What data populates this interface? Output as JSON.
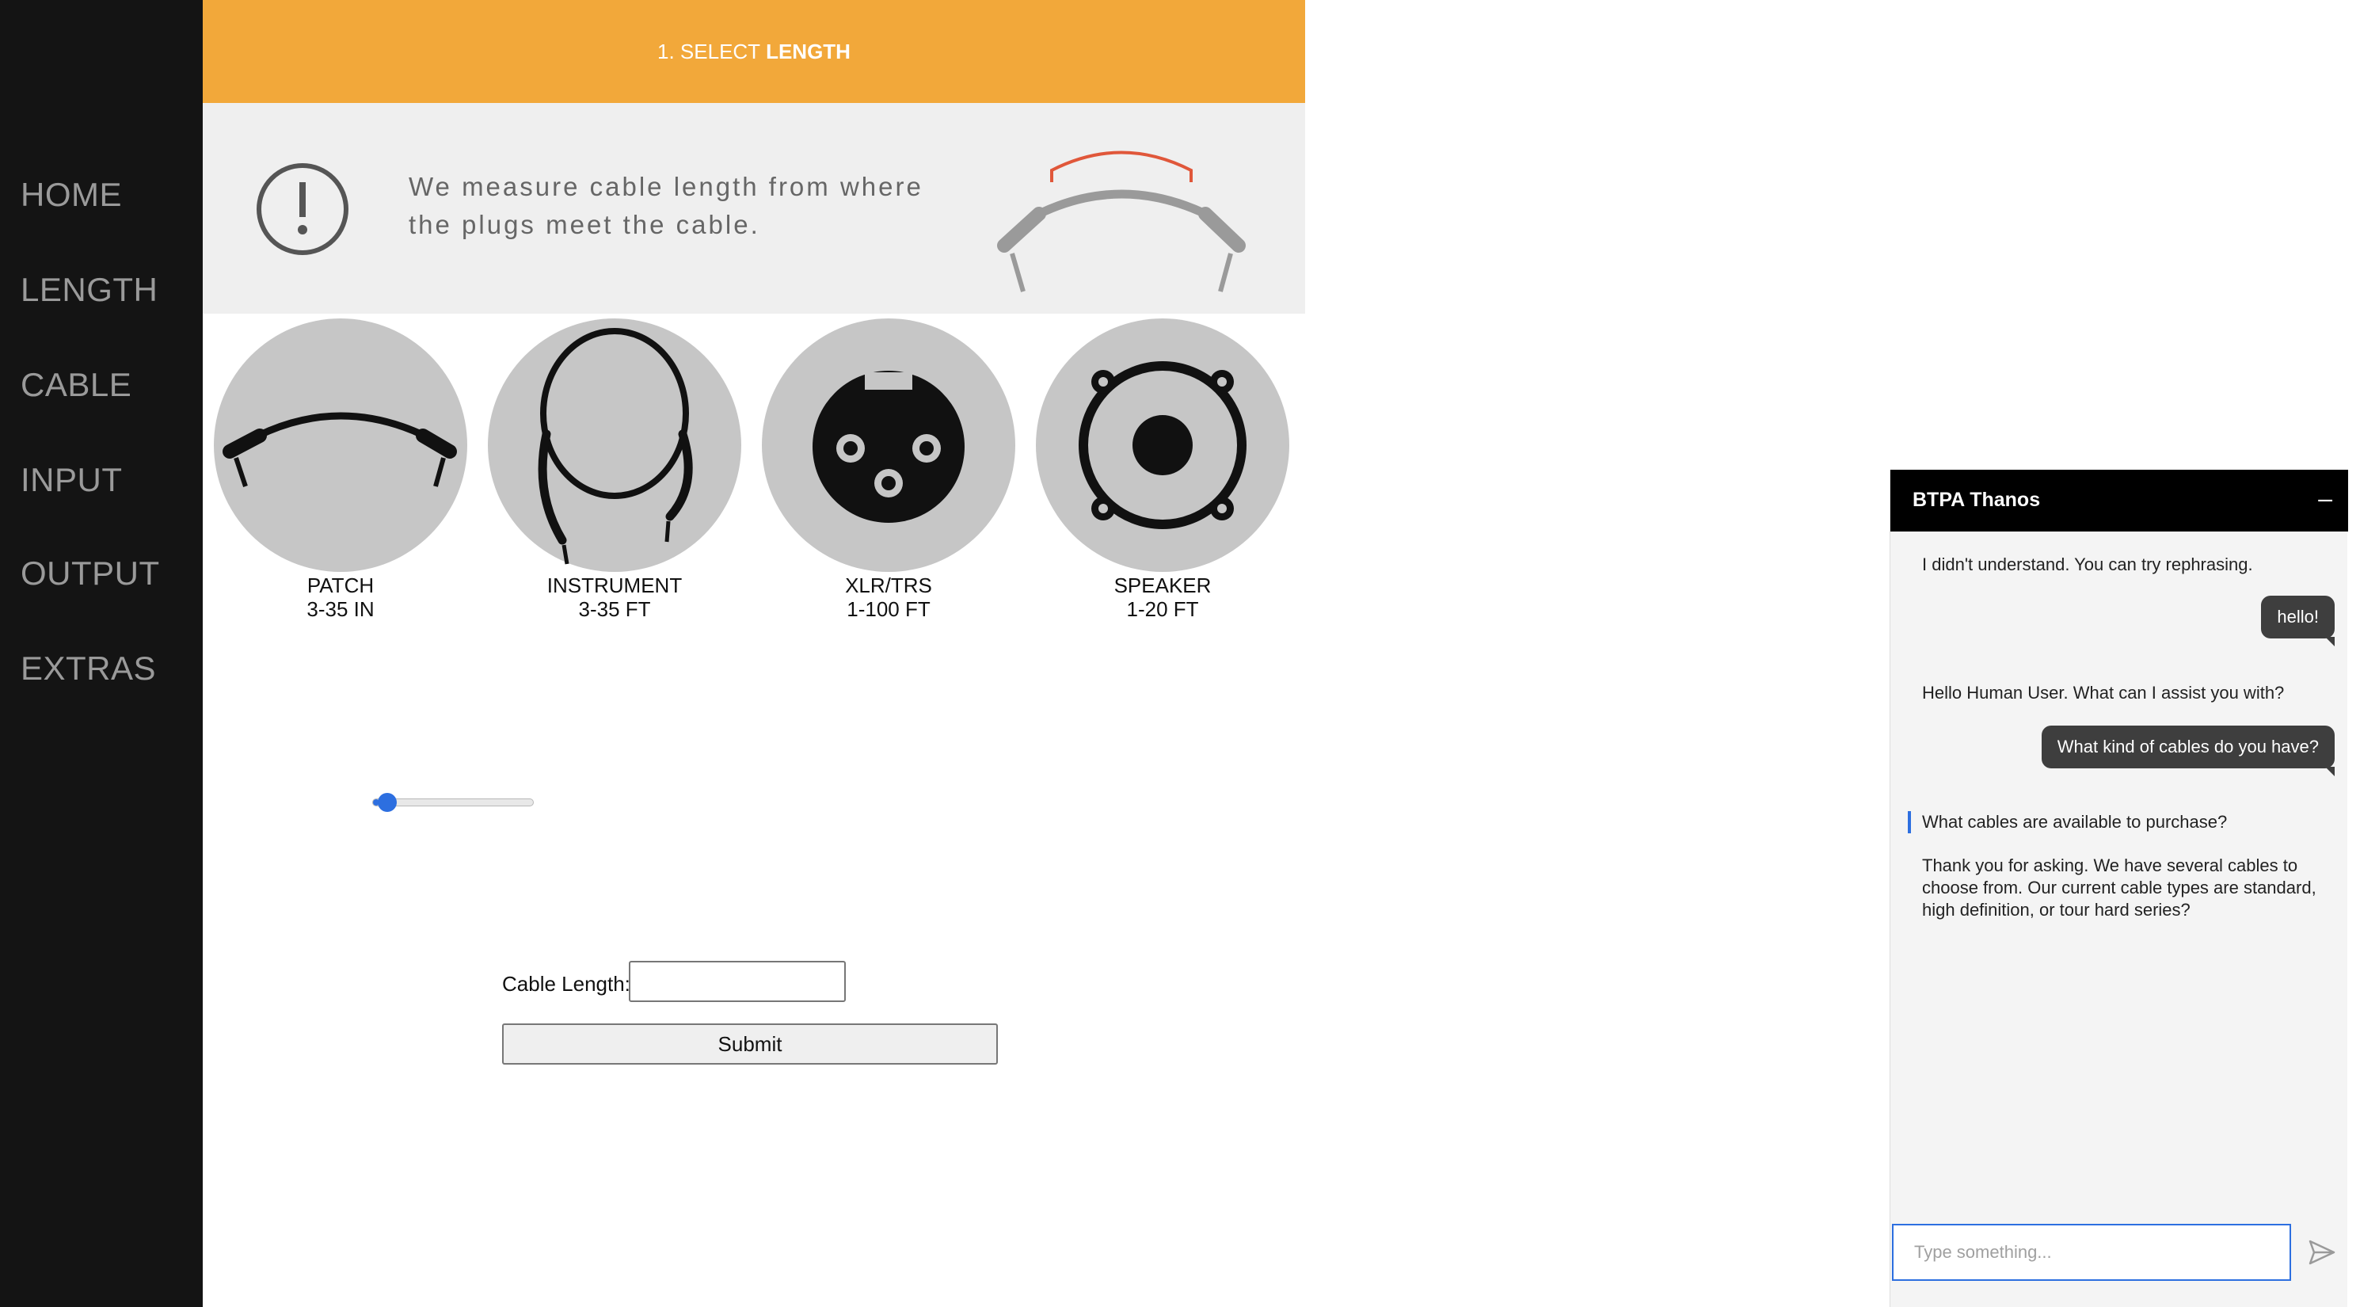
{
  "sidebar": {
    "items": [
      {
        "label": "HOME"
      },
      {
        "label": "LENGTH"
      },
      {
        "label": "CABLE"
      },
      {
        "label": "INPUT"
      },
      {
        "label": "OUTPUT"
      },
      {
        "label": "EXTRAS"
      }
    ]
  },
  "header": {
    "step_prefix": "1. SELECT",
    "step_bold": "LENGTH"
  },
  "info_banner": {
    "text_line1": "We measure cable length from where",
    "text_line2": "the plugs meet the cable."
  },
  "cable_options": [
    {
      "name": "PATCH",
      "range": "3-35 IN",
      "icon": "patch-cable-icon"
    },
    {
      "name": "INSTRUMENT",
      "range": "3-35 FT",
      "icon": "instrument-cable-icon"
    },
    {
      "name": "XLR/TRS",
      "range": "1-100 FT",
      "icon": "xlr-connector-icon"
    },
    {
      "name": "SPEAKER",
      "range": "1-20 FT",
      "icon": "speaker-icon"
    }
  ],
  "slider": {
    "value_fraction": 0.04
  },
  "form": {
    "length_label": "Cable Length:",
    "length_value": "",
    "submit_label": "Submit"
  },
  "chat": {
    "title": "BTPA Thanos",
    "minimize_label": "–",
    "input_placeholder": "Type something...",
    "messages": [
      {
        "from": "bot",
        "text": "I didn't understand. You can try rephrasing."
      },
      {
        "from": "user",
        "text": "hello!"
      },
      {
        "from": "bot",
        "text": "Hello Human User. What can I assist you with?"
      },
      {
        "from": "user",
        "text": "What kind of cables do you have?"
      },
      {
        "from": "bot",
        "text": "What cables are available to purchase?"
      },
      {
        "from": "bot",
        "text": "Thank you for asking. We have several cables to choose from. Our current cable types are standard, high definition, or tour hard series?"
      }
    ]
  },
  "colors": {
    "header_bg": "#f2a83a",
    "sidebar_bg": "#141414",
    "accent_blue": "#2d6fe0",
    "circle_bg": "#c6c6c6",
    "cable_highlight": "#e0573a"
  }
}
